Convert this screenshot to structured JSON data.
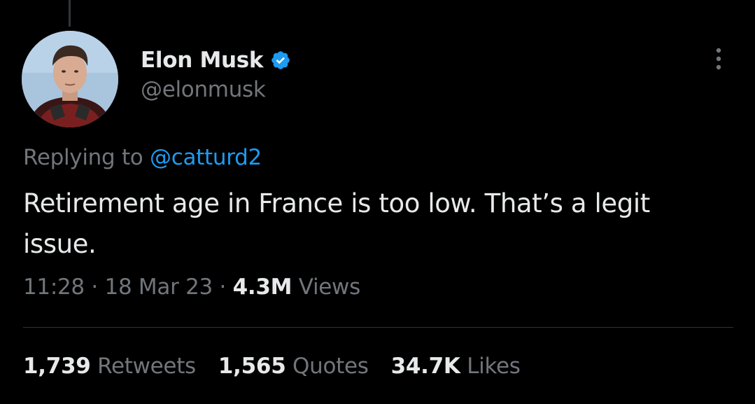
{
  "colors": {
    "background": "#000000",
    "text_primary": "#e7e9ea",
    "text_secondary": "#71767b",
    "accent": "#1d9bf0",
    "divider": "#2f3336"
  },
  "author": {
    "name": "Elon Musk",
    "handle": "@elonmusk",
    "verified": true,
    "verified_icon": "verified-badge-icon",
    "avatar_icon": "profile-photo"
  },
  "tweet": {
    "replying_prefix": "Replying to",
    "replying_to": "@catturd2",
    "text": "Retirement age in France is too low. That’s a legit issue.",
    "time": "11:28",
    "date": "18 Mar 23",
    "views_count": "4.3M",
    "views_label": "Views",
    "separator": "·"
  },
  "stats": {
    "retweets_count": "1,739",
    "retweets_label": "Retweets",
    "quotes_count": "1,565",
    "quotes_label": "Quotes",
    "likes_count": "34.7K",
    "likes_label": "Likes"
  },
  "menu_icon": "more-options-icon"
}
